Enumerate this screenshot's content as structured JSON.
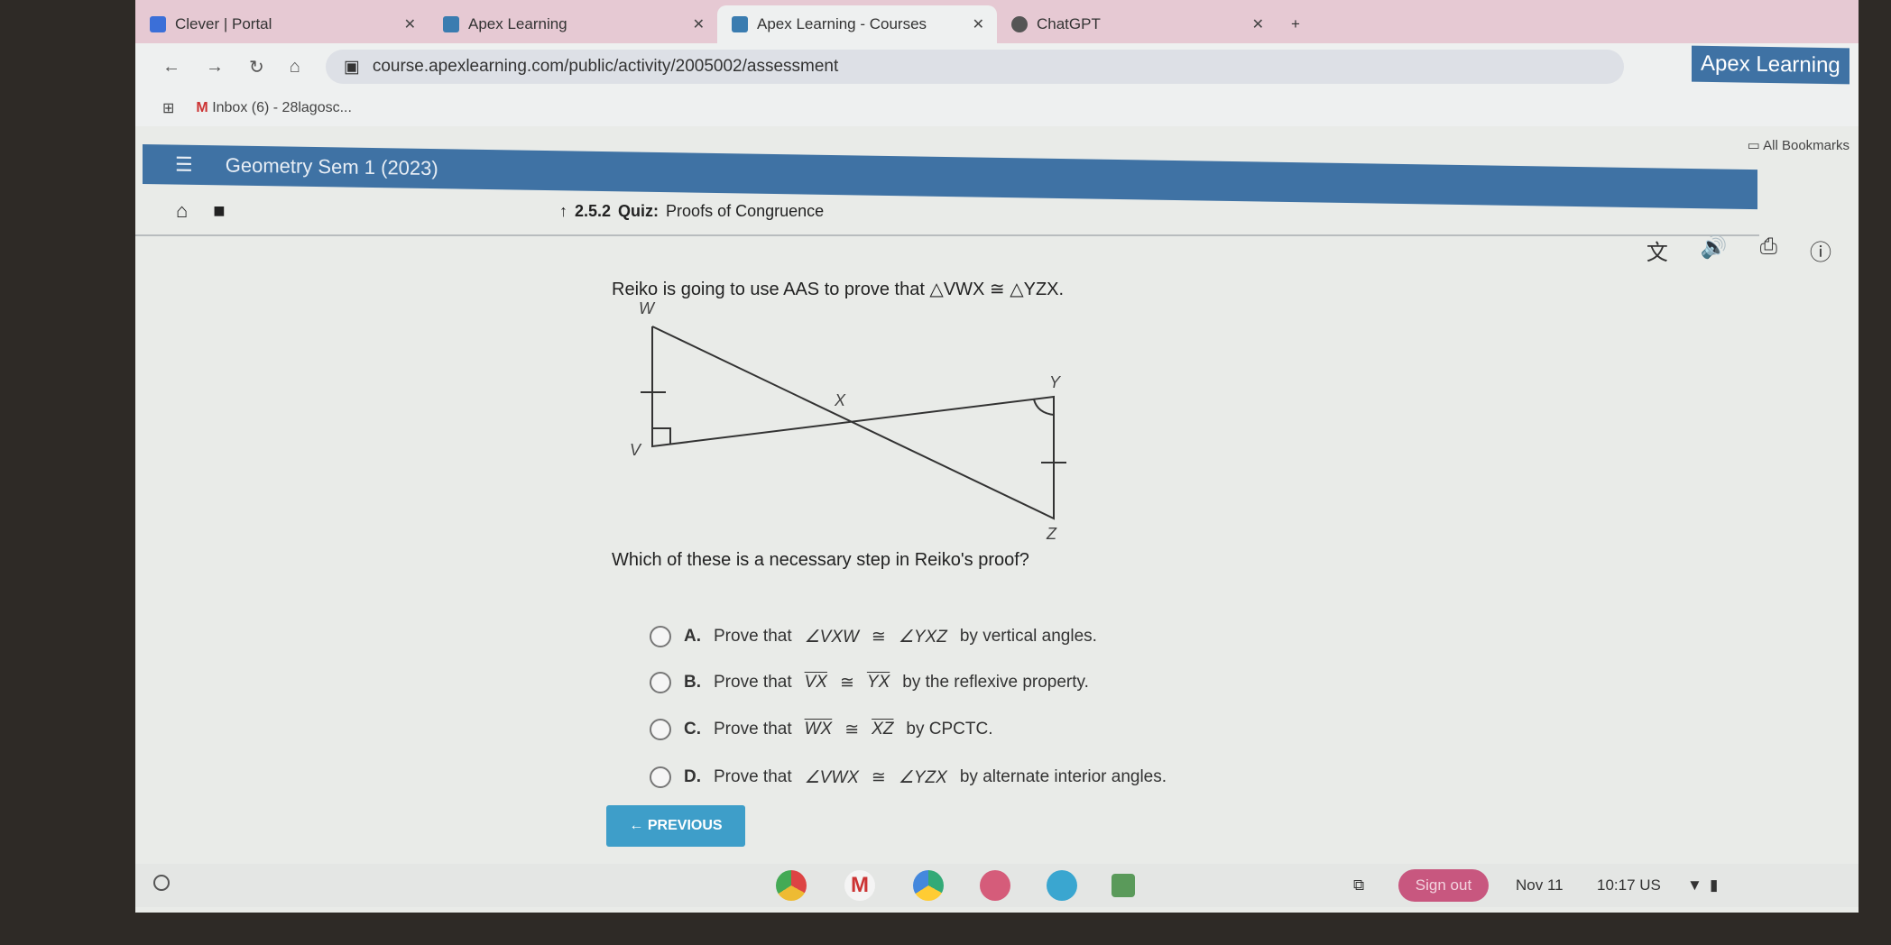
{
  "browser": {
    "tabs": [
      {
        "label": "Clever | Portal",
        "color": "#3b6fd8"
      },
      {
        "label": "Apex Learning",
        "color": "#3a7cb0"
      },
      {
        "label": "Apex Learning - Courses",
        "color": "#3a7cb0",
        "active": true
      },
      {
        "label": "ChatGPT",
        "color": "#555555"
      }
    ],
    "url": "course.apexlearning.com/public/activity/2005002/assessment",
    "bookmark": "Inbox (6) - 28lagosc...",
    "all_bookmarks": "All Bookmarks"
  },
  "header": {
    "course": "Geometry Sem 1 (2023)",
    "brand": "Apex Learning",
    "color": "#3f72a4"
  },
  "sub": {
    "number": "2.5.2",
    "kind": "Quiz:",
    "title": "Proofs of Congruence"
  },
  "question": {
    "prompt": "Reiko is going to use AAS to prove that △VWX ≅ △YZX.",
    "diagram_labels": {
      "W": "W",
      "V": "V",
      "X": "X",
      "Y": "Y",
      "Z": "Z"
    },
    "ask": "Which of these is a necessary step in Reiko's proof?",
    "options": [
      {
        "letter": "A.",
        "pre": "Prove that",
        "a": "∠VXW",
        "b": "∠YXZ",
        "post": "by vertical angles.",
        "seg": false
      },
      {
        "letter": "B.",
        "pre": "Prove that",
        "a": "VX",
        "b": "YX",
        "post": "by the reflexive property.",
        "seg": true
      },
      {
        "letter": "C.",
        "pre": "Prove that",
        "a": "WX",
        "b": "XZ",
        "post": "by CPCTC.",
        "seg": true
      },
      {
        "letter": "D.",
        "pre": "Prove that",
        "a": "∠VWX",
        "b": "∠YZX",
        "post": "by alternate interior angles.",
        "seg": false
      }
    ],
    "cong": "≅"
  },
  "nav": {
    "previous": "← PREVIOUS",
    "accent": "#3e9ec9"
  },
  "taskbar": {
    "sign_out": "Sign out",
    "date": "Nov 11",
    "time": "10:17 US"
  }
}
